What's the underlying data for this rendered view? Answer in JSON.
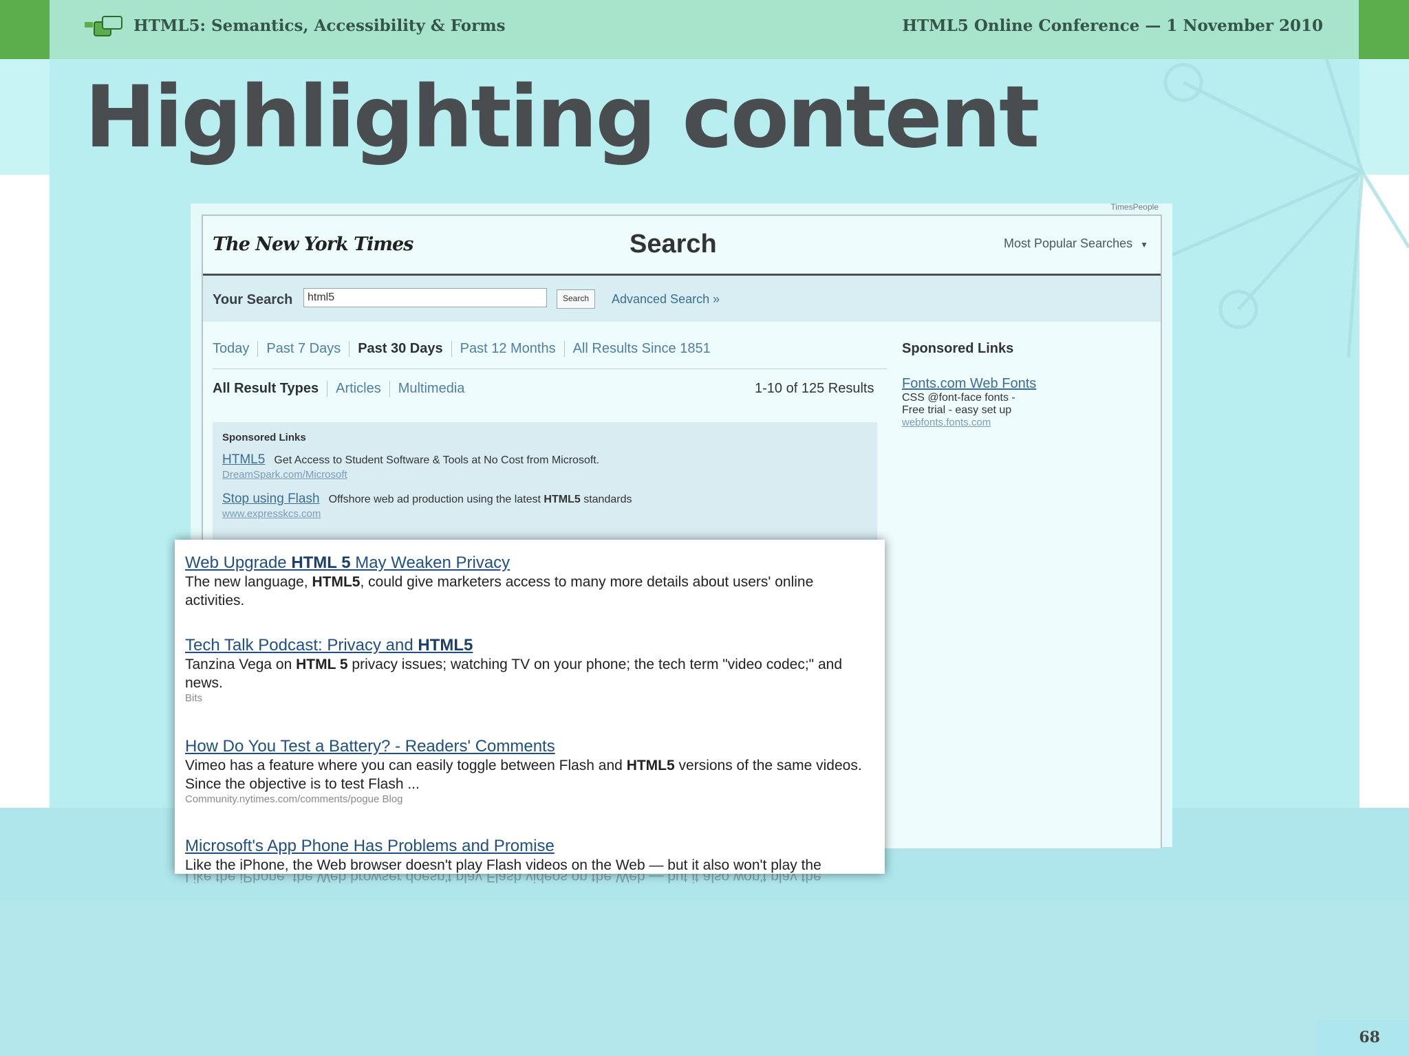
{
  "header": {
    "deck_title": "HTML5: Semantics, Accessibility & Forms",
    "conference": "HTML5 Online Conference — 1 November 2010"
  },
  "slide": {
    "title": "Highlighting content",
    "page_number": "68"
  },
  "screenshot": {
    "timespeople": "TimesPeople",
    "logo_text": "The New York Times",
    "heading": "Search",
    "most_popular": "Most Popular Searches",
    "your_search_label": "Your Search",
    "search_value": "html5",
    "search_button": "Search",
    "advanced_search": "Advanced Search »",
    "time_ranges": [
      "Today",
      "Past 7 Days",
      "Past 30 Days",
      "Past 12 Months",
      "All Results Since 1851"
    ],
    "active_time_range": "Past 30 Days",
    "result_types": [
      "All Result Types",
      "Articles",
      "Multimedia"
    ],
    "active_result_type": "All Result Types",
    "result_count": "1-10 of 125 Results",
    "sponsored": {
      "title": "Sponsored Links",
      "items": [
        {
          "link": "HTML5",
          "desc": "Get Access to Student Software & Tools at No Cost from Microsoft.",
          "url": "DreamSpark.com/Microsoft"
        },
        {
          "link": "Stop using Flash",
          "desc_pre": "Offshore web ad production using the latest ",
          "desc_bold": "HTML5",
          "desc_post": " standards",
          "url": "www.expresskcs.com"
        }
      ]
    },
    "sidebar": {
      "title": "Sponsored Links",
      "link": "Fonts.com Web Fonts",
      "line1": "CSS @font-face fonts -",
      "line2": "Free trial - easy set up",
      "url": "webfonts.fonts.com"
    }
  },
  "results": [
    {
      "title_pre": "Web Upgrade ",
      "title_bold": "HTML 5",
      "title_post": " May Weaken Privacy",
      "desc_pre": "The new language, ",
      "desc_bold": "HTML5",
      "desc_post": ", could give marketers access to many more details about users' online activities.",
      "source": ""
    },
    {
      "title_pre": "Tech Talk Podcast: Privacy and ",
      "title_bold": "HTML5",
      "title_post": "",
      "desc_pre": "Tanzina Vega on ",
      "desc_bold": "HTML 5",
      "desc_post": " privacy issues; watching TV on your phone; the tech term \"video codec;\" and news.",
      "source": "Bits"
    },
    {
      "title_pre": "How Do You Test a Battery? - Readers' Comments",
      "title_bold": "",
      "title_post": "",
      "desc_pre": "Vimeo has a feature where you can easily toggle between Flash and ",
      "desc_bold": "HTML5",
      "desc_post": " versions of the same videos. Since the objective is to test Flash ...",
      "source": "Community.nytimes.com/comments/pogue Blog"
    },
    {
      "title_pre": "Microsoft's App Phone Has Problems and Promise",
      "title_bold": "",
      "title_post": "",
      "desc_pre": "Like the iPhone, the Web browser doesn't play Flash videos on the Web — but it also won't play the",
      "desc_bold": "",
      "desc_post": "",
      "source": ""
    }
  ]
}
